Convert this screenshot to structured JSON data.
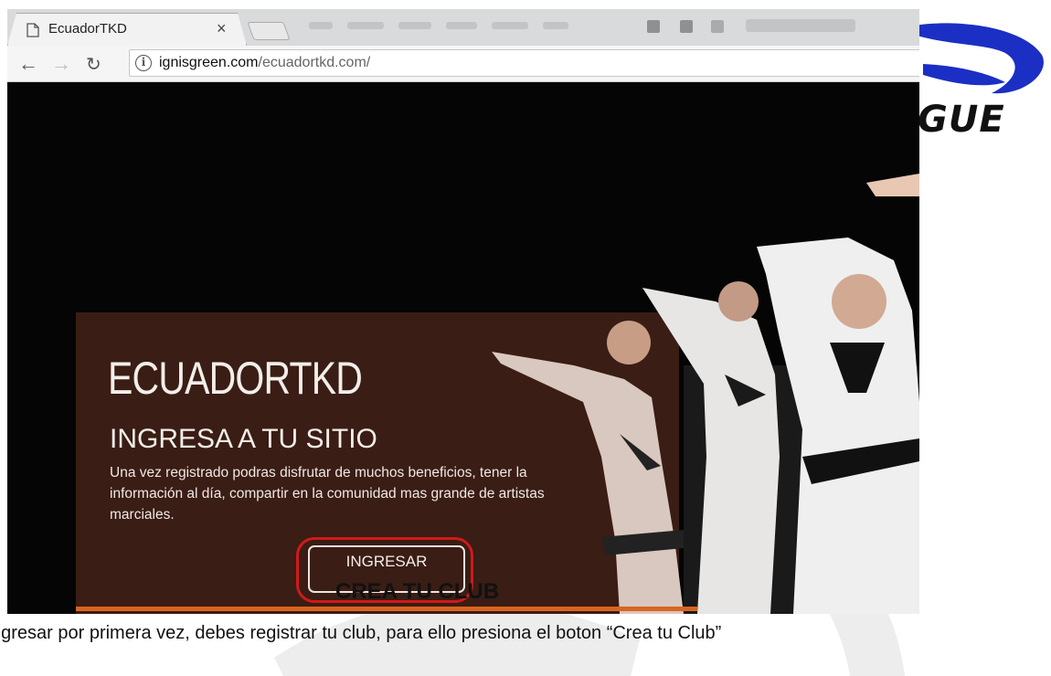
{
  "browser": {
    "tab_title": "EcuadorTKD",
    "tab_close": "×",
    "url_host": "ignisgreen.com",
    "url_path": "/ecuadortkd.com/"
  },
  "hero": {
    "title": "ECUADORTKD",
    "subtitle": "INGRESA A TU SITIO",
    "description": "Una vez registrado podras disfrutar de muchos beneficios, tener la información al día, compartir en la comunidad mas grande de artistas marciales.",
    "button_label": "INGRESAR"
  },
  "document": {
    "logo_text": "GUE",
    "section_heading": "CREA TU CLUB",
    "caption": "ngresar por primera vez, debes registrar tu club, para ello presiona el boton “Crea tu Club”"
  },
  "colors": {
    "panel": "#3a1d14",
    "accent_line": "#d96420",
    "highlight_ring": "#d11919"
  }
}
